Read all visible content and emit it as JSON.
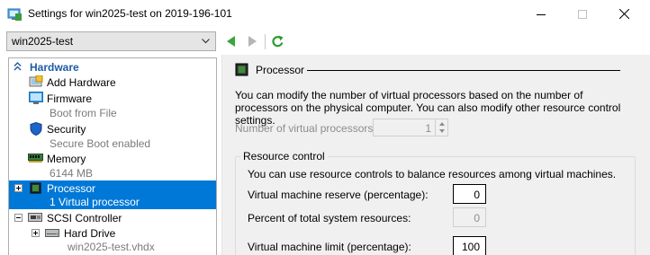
{
  "window": {
    "title": "Settings for win2025-test on 2019-196-101"
  },
  "toolbar": {
    "vm_selected": "win2025-test"
  },
  "tree": {
    "section_label": "Hardware",
    "items": [
      {
        "label": "Add Hardware",
        "sub": ""
      },
      {
        "label": "Firmware",
        "sub": "Boot from File"
      },
      {
        "label": "Security",
        "sub": "Secure Boot enabled"
      },
      {
        "label": "Memory",
        "sub": "6144 MB"
      },
      {
        "label": "Processor",
        "sub": "1 Virtual processor"
      },
      {
        "label": "SCSI Controller",
        "sub": ""
      },
      {
        "label": "Hard Drive",
        "sub": "win2025-test.vhdx"
      }
    ]
  },
  "panel": {
    "title": "Processor",
    "description": "You can modify the number of virtual processors based on the number of processors on the physical computer. You can also modify other resource control settings.",
    "num_processors_label": "Number of virtual processors:",
    "num_processors_value": "1",
    "resource_control": {
      "title": "Resource control",
      "description": "You can use resource controls to balance resources among virtual machines.",
      "fields": [
        {
          "label": "Virtual machine reserve (percentage):",
          "value": "0"
        },
        {
          "label": "Percent of total system resources:",
          "value": "0"
        },
        {
          "label": "Virtual machine limit (percentage):",
          "value": "100"
        }
      ]
    }
  }
}
